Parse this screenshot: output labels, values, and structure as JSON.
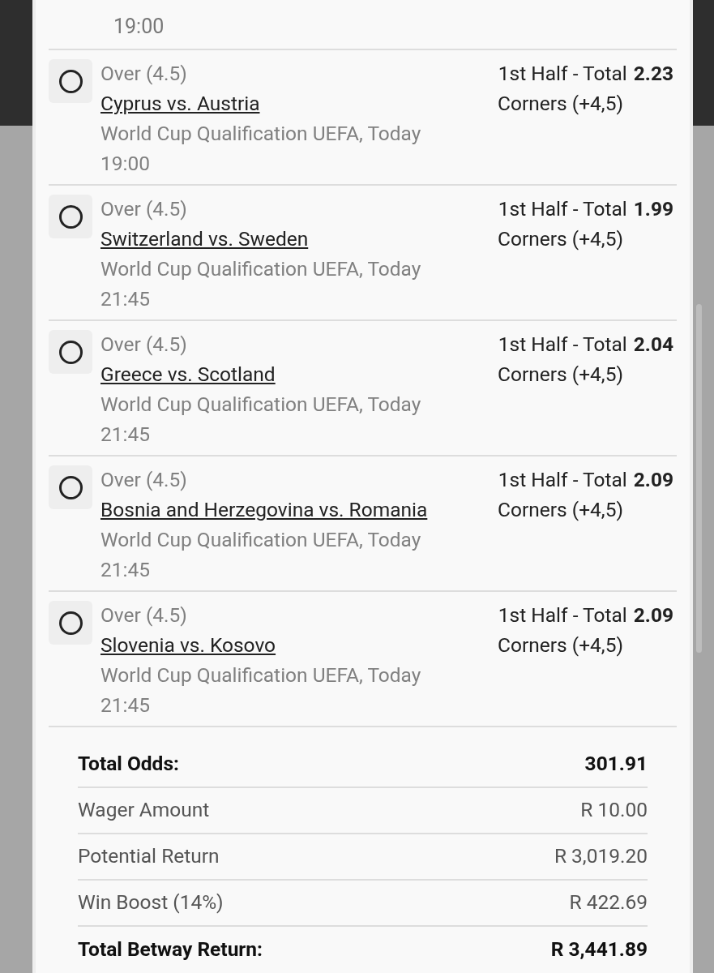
{
  "top_fragment": {
    "time": "19:00"
  },
  "selections": [
    {
      "pick": "Over (4.5)",
      "match": "Cyprus vs. Austria",
      "competition": "World Cup Qualification UEFA, Today",
      "time": "19:00",
      "market": "1st Half - Total",
      "market_line2": "Corners (+4,5)",
      "odds": "2.23",
      "checked": false
    },
    {
      "pick": "Over (4.5)",
      "match": "Switzerland vs. Sweden",
      "competition": "World Cup Qualification UEFA, Today",
      "time": "21:45",
      "market": "1st Half - Total",
      "market_line2": "Corners (+4,5)",
      "odds": "1.99",
      "checked": false
    },
    {
      "pick": "Over (4.5)",
      "match": "Greece vs. Scotland",
      "competition": "World Cup Qualification UEFA, Today",
      "time": "21:45",
      "market": "1st Half - Total",
      "market_line2": "Corners (+4,5)",
      "odds": "2.04",
      "checked": false
    },
    {
      "pick": "Over (4.5)",
      "match": "Bosnia and Herzegovina vs. Romania",
      "competition": "World Cup Qualification UEFA, Today",
      "time": "21:45",
      "market": "1st Half - Total",
      "market_line2": "Corners (+4,5)",
      "odds": "2.09",
      "checked": false
    },
    {
      "pick": "Over (4.5)",
      "match": "Slovenia vs. Kosovo",
      "competition": "World Cup Qualification UEFA, Today",
      "time": "21:45",
      "market": "1st Half - Total",
      "market_line2": "Corners (+4,5)",
      "odds": "2.09",
      "checked": false
    }
  ],
  "summary": [
    {
      "label": "Total Odds:",
      "value": "301.91",
      "kind": "total"
    },
    {
      "label": "Wager Amount",
      "value": "R 10.00",
      "kind": "normal"
    },
    {
      "label": "Potential Return",
      "value": "R 3,019.20",
      "kind": "normal"
    },
    {
      "label": "Win Boost (14%)",
      "value": "R 422.69",
      "kind": "normal"
    },
    {
      "label": "Total Betway Return:",
      "value": "R 3,441.89",
      "kind": "total"
    }
  ]
}
